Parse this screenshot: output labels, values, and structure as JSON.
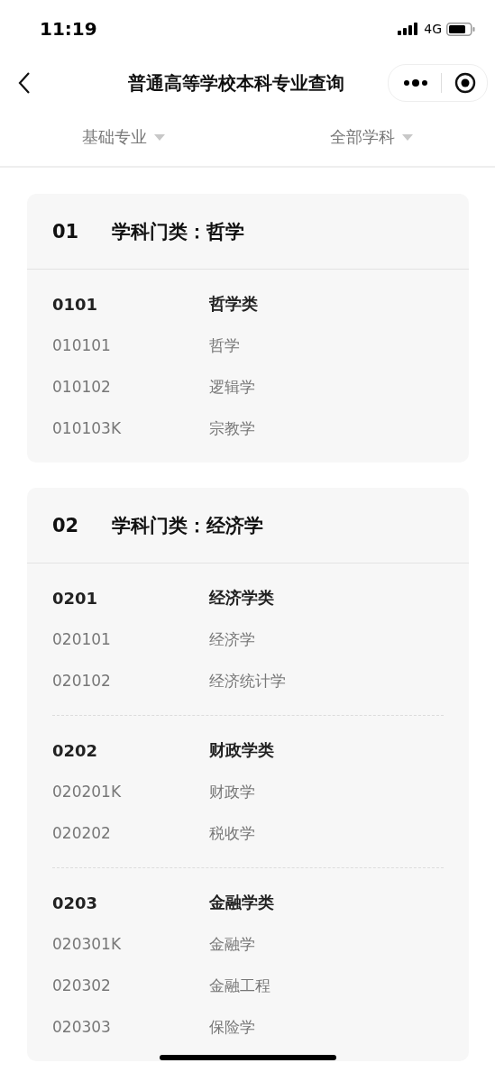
{
  "status_bar": {
    "time": "11:19",
    "network": "4G"
  },
  "nav": {
    "title": "普通高等学校本科专业查询"
  },
  "filters": [
    {
      "label": "基础专业"
    },
    {
      "label": "全部学科"
    }
  ],
  "categories": [
    {
      "code": "01",
      "title": "学科门类：哲学",
      "groups": [
        {
          "code": "0101",
          "name": "哲学类",
          "majors": [
            {
              "code": "010101",
              "name": "哲学"
            },
            {
              "code": "010102",
              "name": "逻辑学"
            },
            {
              "code": "010103K",
              "name": "宗教学"
            }
          ]
        }
      ]
    },
    {
      "code": "02",
      "title": "学科门类：经济学",
      "groups": [
        {
          "code": "0201",
          "name": "经济学类",
          "majors": [
            {
              "code": "020101",
              "name": "经济学"
            },
            {
              "code": "020102",
              "name": "经济统计学"
            }
          ]
        },
        {
          "code": "0202",
          "name": "财政学类",
          "majors": [
            {
              "code": "020201K",
              "name": "财政学"
            },
            {
              "code": "020202",
              "name": "税收学"
            }
          ]
        },
        {
          "code": "0203",
          "name": "金融学类",
          "majors": [
            {
              "code": "020301K",
              "name": "金融学"
            },
            {
              "code": "020302",
              "name": "金融工程"
            },
            {
              "code": "020303",
              "name": "保险学"
            }
          ]
        }
      ]
    }
  ]
}
